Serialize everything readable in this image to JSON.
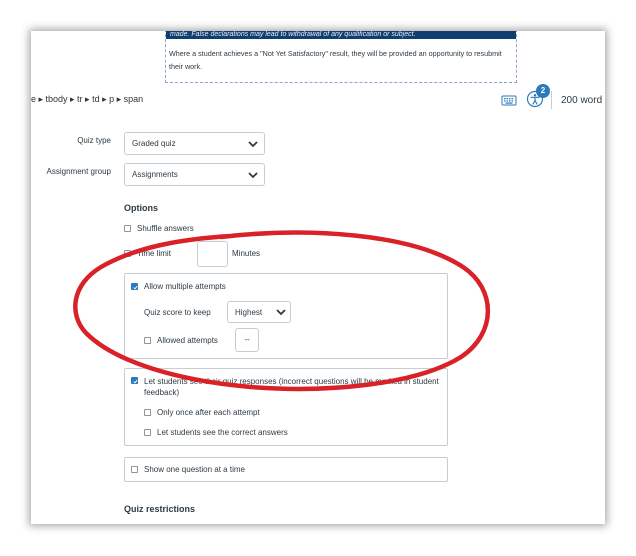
{
  "editor": {
    "banner_text": "made. False declarations may lead to withdrawal of any qualification or subject.",
    "paragraph": "Where a student achieves a \"Not Yet Satisfactory\" result, they will be provided an opportunity to resubmit their work."
  },
  "status_bar": {
    "breadcrumb": "e ▸ tbody ▸ tr ▸ td ▸ p ▸ span",
    "keyboard_icon": "keyboard-icon",
    "accessibility_icon": "accessibility-icon",
    "issue_count": "2",
    "word_count": "200 word"
  },
  "form": {
    "quiz_type": {
      "label": "Quiz type",
      "value": "Graded quiz"
    },
    "assignment_group": {
      "label": "Assignment group",
      "value": "Assignments"
    },
    "options_heading": "Options",
    "shuffle_answers": {
      "label": "Shuffle answers",
      "checked": false
    },
    "time_limit": {
      "label": "Time limit",
      "checked": false,
      "value": "",
      "unit": "Minutes"
    },
    "multiple_attempts": {
      "label": "Allow multiple attempts",
      "checked": true,
      "score_label": "Quiz score to keep",
      "score_value": "Highest",
      "allowed_attempts_label": "Allowed attempts",
      "allowed_attempts_checked": false,
      "allowed_attempts_value": "--"
    },
    "see_responses": {
      "label": "Let students see their quiz responses (incorrect questions will be marked in student feedback)",
      "checked": true,
      "only_once": {
        "label": "Only once after each attempt",
        "checked": false
      },
      "see_correct": {
        "label": "Let students see the correct answers",
        "checked": false
      }
    },
    "one_question": {
      "label": "Show one question at a time",
      "checked": false
    },
    "restrictions_heading": "Quiz restrictions"
  },
  "colors": {
    "annotation_ring": "#d92127",
    "checkbox_checked": "#2b7abc",
    "banner": "#103e70"
  }
}
